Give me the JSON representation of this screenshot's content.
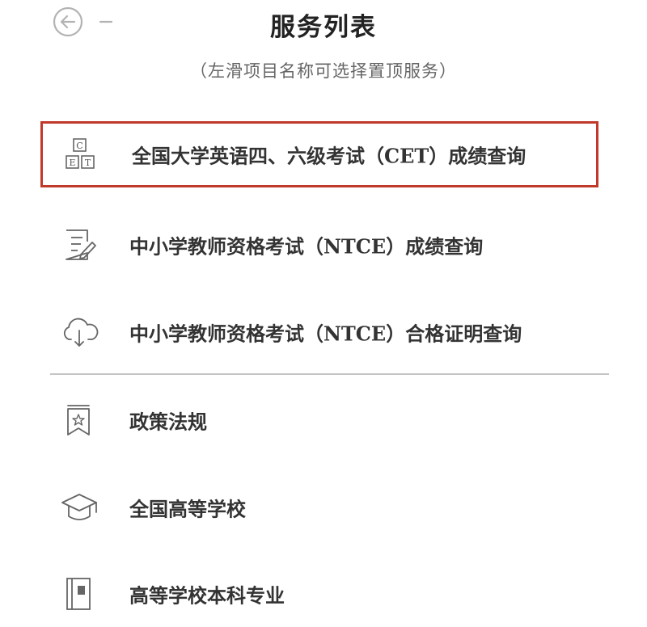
{
  "header": {
    "title": "服务列表",
    "subtitle": "（左滑项目名称可选择置顶服务）",
    "back_icon": "arrow-left-circle-icon"
  },
  "services": [
    {
      "label": "全国大学英语四、六级考试（CET）成绩查询",
      "icon": "cet-icon",
      "highlighted": true
    },
    {
      "label": "中小学教师资格考试（NTCE）成绩查询",
      "icon": "edit-document-icon",
      "highlighted": false
    },
    {
      "label": "中小学教师资格考试（NTCE）合格证明查询",
      "icon": "cloud-download-icon",
      "highlighted": false
    },
    {
      "label": "政策法规",
      "icon": "bookmark-star-icon",
      "highlighted": false
    },
    {
      "label": "全国高等学校",
      "icon": "graduation-cap-icon",
      "highlighted": false
    },
    {
      "label": "高等学校本科专业",
      "icon": "book-icon",
      "highlighted": false
    }
  ],
  "colors": {
    "highlight_border": "#c0392b",
    "text": "#333333",
    "icon": "#666666",
    "divider": "#c4c4c4"
  }
}
